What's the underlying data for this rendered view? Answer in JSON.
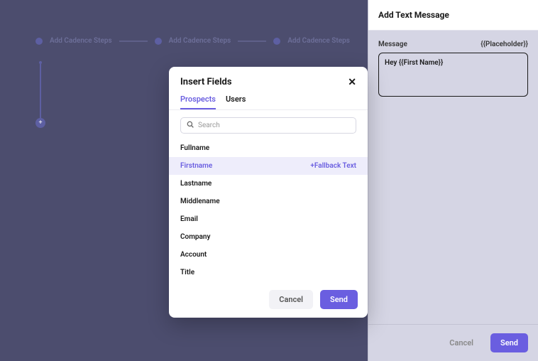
{
  "steps": {
    "items": [
      {
        "label": "Add Cadence Steps"
      },
      {
        "label": "Add Cadence Steps"
      },
      {
        "label": "Add Cadence Steps"
      }
    ]
  },
  "timeline": {
    "icon_glyph": "+"
  },
  "side_panel": {
    "title": "Add Text Message",
    "message_label": "Message",
    "placeholder_label": "{{Placeholder}}",
    "message_value": "Hey {{First Name}}",
    "cancel_label": "Cancel",
    "send_label": "Send"
  },
  "modal": {
    "title": "Insert Fields",
    "tabs": [
      {
        "label": "Prospects",
        "active": true
      },
      {
        "label": "Users",
        "active": false
      }
    ],
    "search_placeholder": "Search",
    "fields": [
      {
        "label": "Fullname",
        "selected": false
      },
      {
        "label": "Firstname",
        "selected": true,
        "fallback": "+Fallback Text"
      },
      {
        "label": "Lastname",
        "selected": false
      },
      {
        "label": "Middlename",
        "selected": false
      },
      {
        "label": "Email",
        "selected": false
      },
      {
        "label": "Company",
        "selected": false
      },
      {
        "label": "Account",
        "selected": false
      },
      {
        "label": "Title",
        "selected": false
      }
    ],
    "cancel_label": "Cancel",
    "send_label": "Send"
  }
}
